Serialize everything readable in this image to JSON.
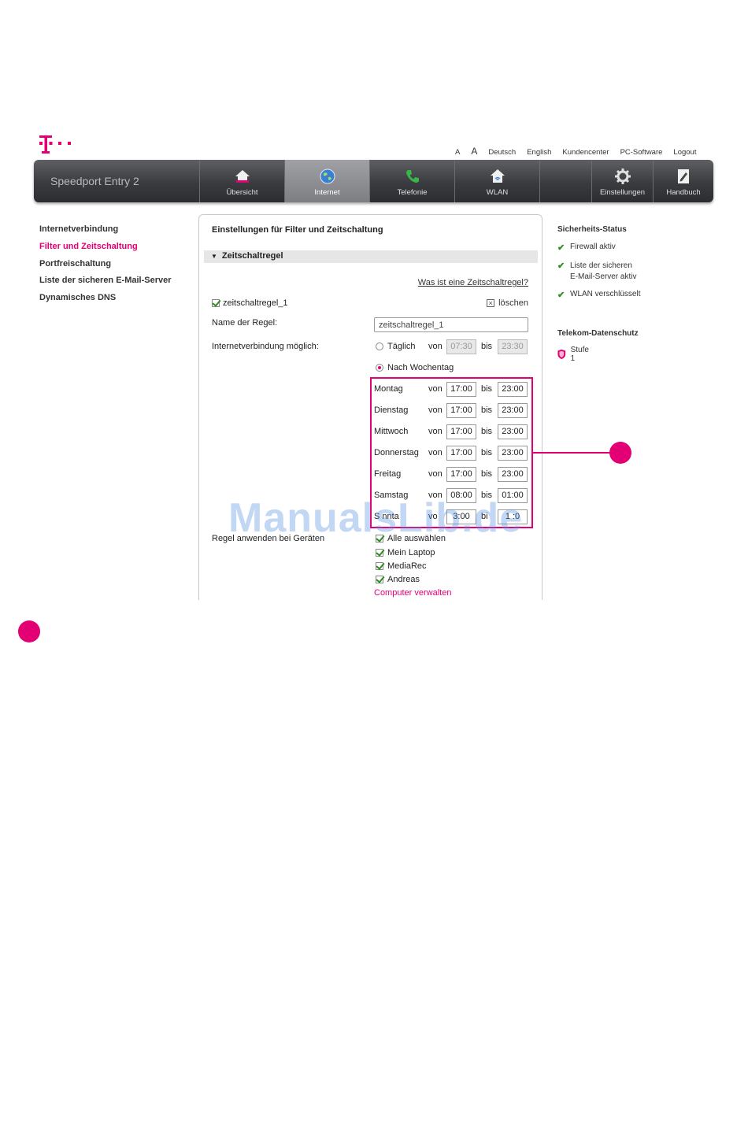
{
  "colors": {
    "accent": "#e20074",
    "navbar": "#3a3b3e",
    "check": "#2f8a1f"
  },
  "topmenu": {
    "font_small": "A",
    "font_large": "A",
    "lang_de": "Deutsch",
    "lang_en": "English",
    "customer_center": "Kundencenter",
    "pc_software": "PC-Software",
    "logout": "Logout"
  },
  "navbar": {
    "brand": "Speedport Entry 2",
    "tabs": [
      {
        "label": "Übersicht",
        "icon": "home-icon"
      },
      {
        "label": "Internet",
        "icon": "globe-icon"
      },
      {
        "label": "Telefonie",
        "icon": "phone-icon"
      },
      {
        "label": "WLAN",
        "icon": "wlan-house-icon"
      },
      {
        "label": "Einstellungen",
        "icon": "gear-icon"
      },
      {
        "label": "Handbuch",
        "icon": "manual-icon"
      }
    ],
    "active": "Internet"
  },
  "leftnav": [
    "Internetverbindung",
    "Filter und Zeitschaltung",
    "Portfreischaltung",
    "Liste der sicheren E-Mail-Server",
    "Dynamisches DNS"
  ],
  "panel": {
    "title": "Einstellungen für Filter und Zeitschaltung",
    "section": "Zeitschaltregel",
    "help_link": "Was ist eine Zeitschaltregel?",
    "rule_name_label": "zeitschaltregel_1",
    "delete": "löschen",
    "name_label": "Name der Regel:",
    "name_value": "zeitschaltregel_1",
    "connection_label": "Internetverbindung möglich:",
    "daily": {
      "label": "Täglich",
      "von": "von",
      "bis": "bis",
      "from": "07:30",
      "to": "23:30"
    },
    "weekday_option": "Nach Wochentag",
    "days": [
      {
        "name": "Montag",
        "von": "von",
        "bis": "bis",
        "from": "17:00",
        "to": "23:00"
      },
      {
        "name": "Dienstag",
        "von": "von",
        "bis": "bis",
        "from": "17:00",
        "to": "23:00"
      },
      {
        "name": "Mittwoch",
        "von": "von",
        "bis": "bis",
        "from": "17:00",
        "to": "23:00"
      },
      {
        "name": "Donnerstag",
        "von": "von",
        "bis": "bis",
        "from": "17:00",
        "to": "23:00"
      },
      {
        "name": "Freitag",
        "von": "von",
        "bis": "bis",
        "from": "17:00",
        "to": "23:00"
      },
      {
        "name": "Samstag",
        "von": "von",
        "bis": "bis",
        "from": "08:00",
        "to": "01:00"
      },
      {
        "name": "S nnta",
        "von": "vo",
        "bis": "bi",
        "from": "3:00",
        "to": "1 :0"
      }
    ],
    "devices_label": "Regel anwenden bei Geräten",
    "devices": [
      "Alle auswählen",
      "Mein Laptop",
      "MediaRec",
      "Andreas"
    ],
    "manage_link": "Computer verwalten"
  },
  "right": {
    "security_header": "Sicherheits-Status",
    "security_items": [
      "Firewall aktiv",
      "Liste der sicheren\nE-Mail-Server aktiv",
      "WLAN verschlüsselt"
    ],
    "privacy_header": "Telekom-Datenschutz",
    "privacy_level": "Stufe 1"
  },
  "watermark": "ManualsLib.de"
}
